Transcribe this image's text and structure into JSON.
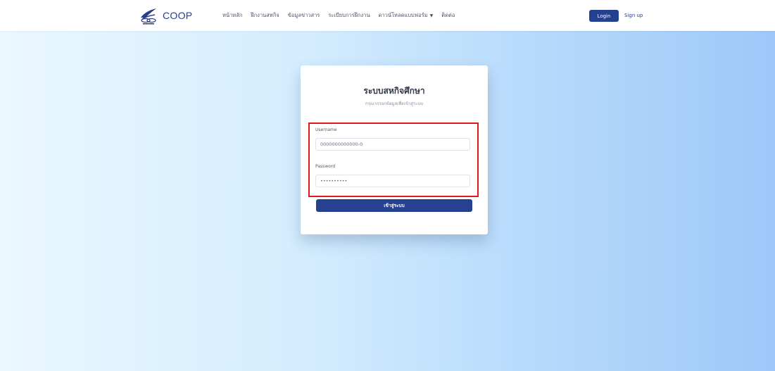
{
  "brand": {
    "text": "COOP"
  },
  "nav": {
    "items": [
      {
        "label": "หน้าหลัก"
      },
      {
        "label": "ฝึกงานสหกิจ"
      },
      {
        "label": "ข้อมูลข่าวสาร"
      },
      {
        "label": "ระเบียบการฝึกงาน"
      },
      {
        "label": "ดาวน์โหลดแบบฟอร์ม"
      },
      {
        "label": "ติดต่อ"
      }
    ],
    "login_label": "Login",
    "signup_label": "Sign up"
  },
  "login_card": {
    "title": "ระบบสหกิจศึกษา",
    "subtitle": "กรุณากรอกข้อมูลเพื่อเข้าสู่ระบบ",
    "username_label": "Username",
    "username_value": "0000000000000-0",
    "password_label": "Password",
    "password_value": "••••••••••",
    "submit_label": "เข้าสู่ระบบ"
  },
  "colors": {
    "brand_blue": "#24418f",
    "highlight_red": "#dc1a1a"
  }
}
